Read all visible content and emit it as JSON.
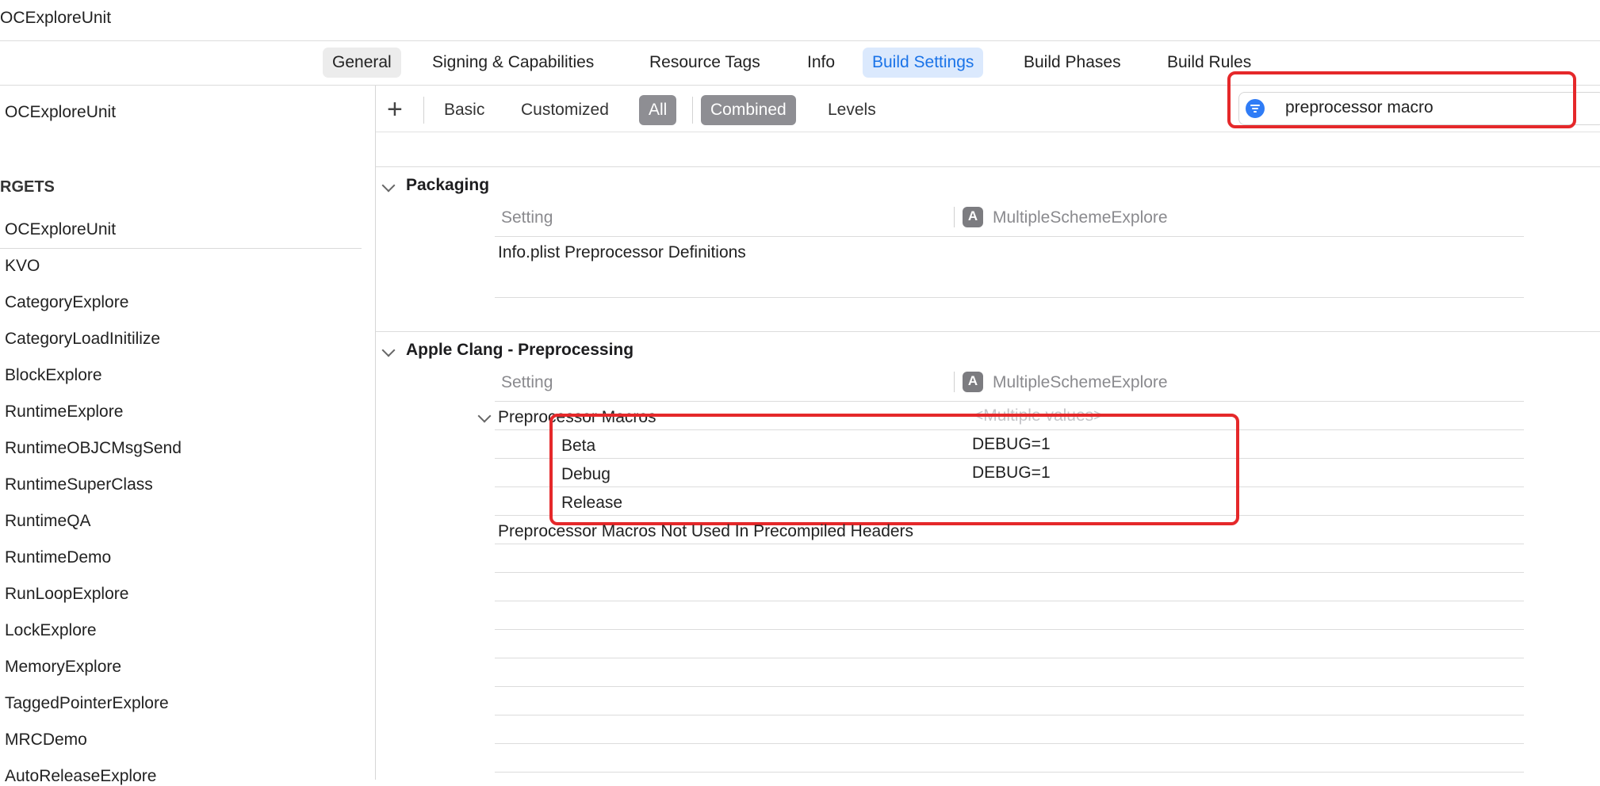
{
  "window": {
    "title": "OCExploreUnit"
  },
  "tabs": [
    {
      "label": "General"
    },
    {
      "label": "Signing & Capabilities"
    },
    {
      "label": "Resource Tags"
    },
    {
      "label": "Info"
    },
    {
      "label": "Build Settings",
      "active": true
    },
    {
      "label": "Build Phases"
    },
    {
      "label": "Build Rules"
    }
  ],
  "sidebar": {
    "project": "OCExploreUnit",
    "targets_header": "RGETS",
    "targets": [
      "OCExploreUnit",
      "KVO",
      "CategoryExplore",
      "CategoryLoadInitilize",
      "BlockExplore",
      "RuntimeExplore",
      "RuntimeOBJCMsgSend",
      "RuntimeSuperClass",
      "RuntimeQA",
      "RuntimeDemo",
      "RunLoopExplore",
      "LockExplore",
      "MemoryExplore",
      "TaggedPointerExplore",
      "MRCDemo",
      "AutoReleaseExplore"
    ]
  },
  "toolbar": {
    "add_label": "+",
    "basic": "Basic",
    "customized": "Customized",
    "all": "All",
    "combined": "Combined",
    "levels": "Levels",
    "search_value": "preprocessor macro"
  },
  "sections": {
    "packaging": {
      "title": "Packaging",
      "col_setting": "Setting",
      "col_target": "MultipleSchemeExplore",
      "row1": "Info.plist Preprocessor Definitions"
    },
    "clang": {
      "title": "Apple Clang - Preprocessing",
      "col_setting": "Setting",
      "col_target": "MultipleSchemeExplore",
      "macros_label": "Preprocessor Macros",
      "macros_value": "<Multiple values>",
      "configs": [
        {
          "name": "Beta",
          "value": "DEBUG=1"
        },
        {
          "name": "Debug",
          "value": "DEBUG=1"
        },
        {
          "name": "Release",
          "value": ""
        }
      ],
      "not_used": "Preprocessor Macros Not Used In Precompiled Headers"
    }
  },
  "colors": {
    "accent": "#1a73e8",
    "highlight_box": "#e5282a",
    "selected_segment": "#8e8e93"
  }
}
